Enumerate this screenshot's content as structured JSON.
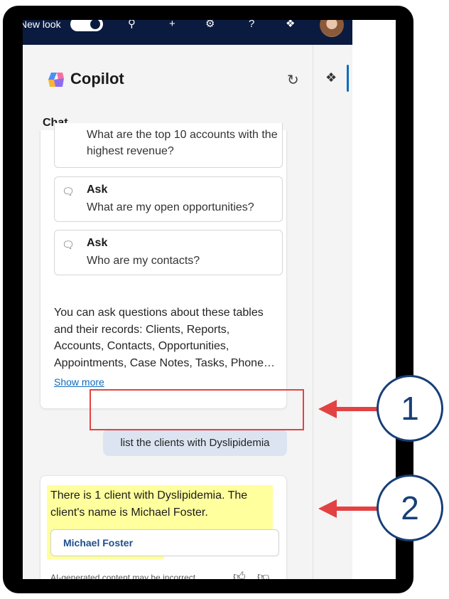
{
  "topbar": {
    "new_look_label": "New look",
    "icons": [
      "lightbulb-icon",
      "plus-icon",
      "gear-icon",
      "help-icon",
      "copilot-icon"
    ]
  },
  "copilot": {
    "title": "Copilot",
    "tab": "Chat",
    "suggestions": [
      {
        "label": "",
        "text": "What are the top 10 accounts with the highest revenue?"
      },
      {
        "label": "Ask",
        "text": "What are my open opportunities?"
      },
      {
        "label": "Ask",
        "text": "Who are my contacts?"
      }
    ],
    "description": "You can ask questions about these tables and their records: Clients, Reports, Accounts, Contacts, Opportunities, Appointments, Case Notes, Tasks, Phone…",
    "show_more": "Show more",
    "user_message": "list the clients with Dyslipidemia",
    "reply": "There is 1 client with Dyslipidemia. The client's name is Michael Foster.",
    "client_button": "Michael Foster",
    "disclaimer": "AI-generated content may be incorrect"
  },
  "callouts": [
    {
      "number": "1"
    },
    {
      "number": "2"
    }
  ],
  "colors": {
    "nav_bg": "#0b1b3f",
    "accent": "#0f6cbd",
    "highlight": "#ffff9e",
    "callout_red": "#e34242",
    "callout_blue": "#173f78"
  }
}
